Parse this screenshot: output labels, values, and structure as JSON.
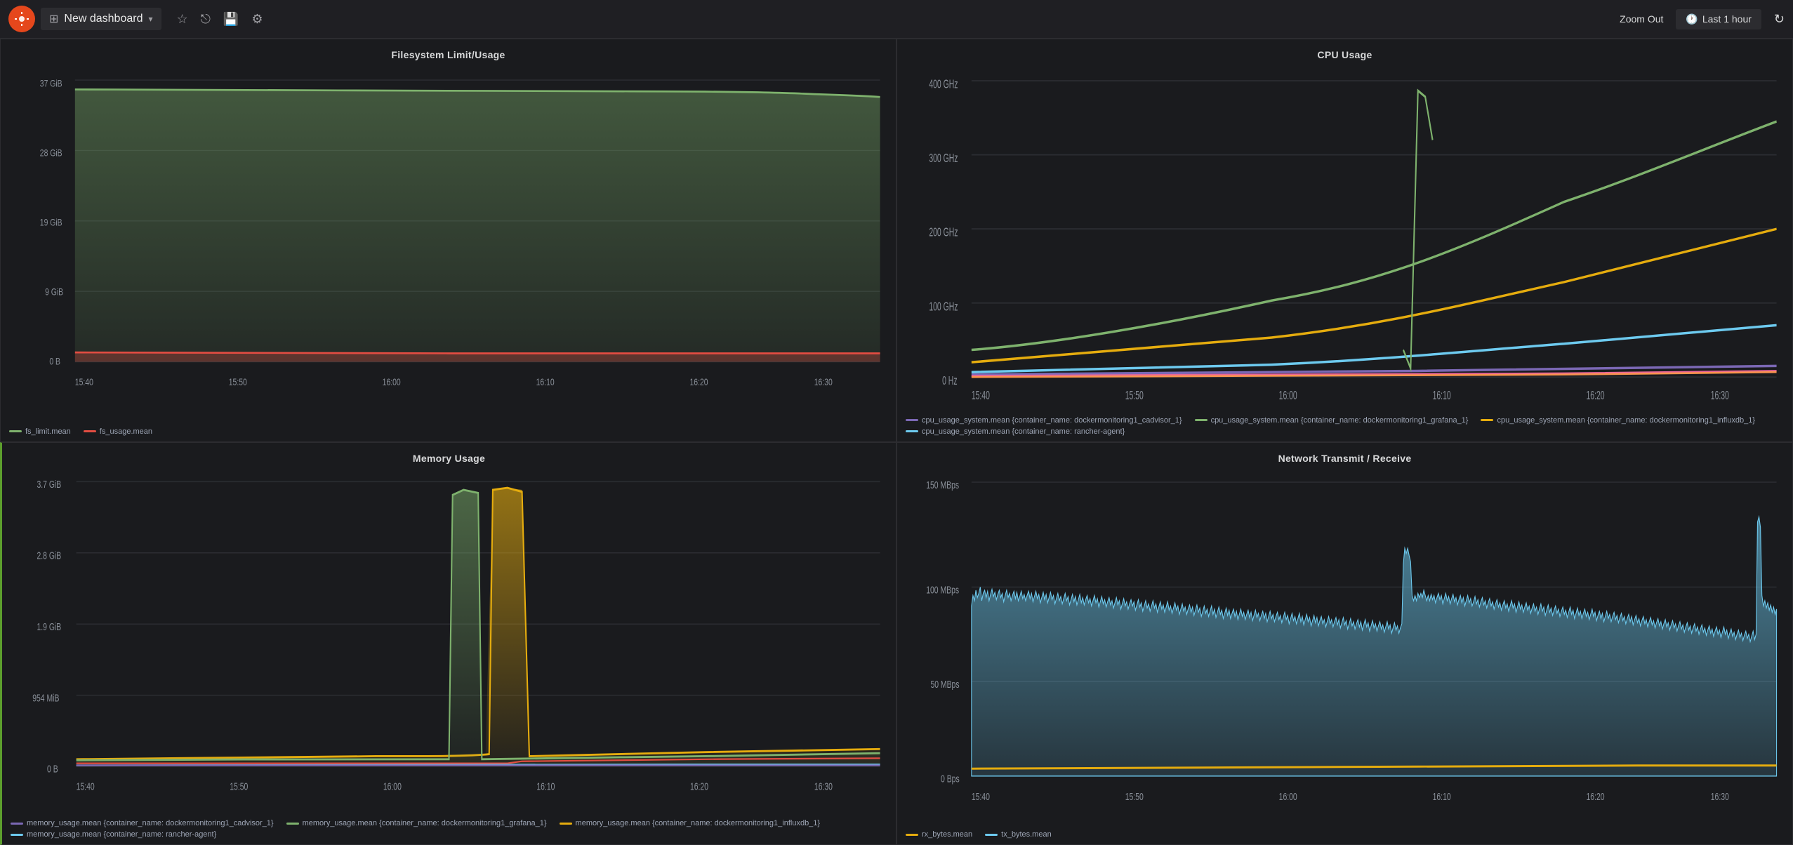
{
  "header": {
    "title": "New dashboard",
    "zoom_out": "Zoom Out",
    "time_range": "Last 1 hour",
    "logo_symbol": "☀"
  },
  "panels": {
    "filesystem": {
      "title": "Filesystem Limit/Usage",
      "y_labels": [
        "37 GiB",
        "28 GiB",
        "19 GiB",
        "9 GiB",
        "0 B"
      ],
      "x_labels": [
        "15:40",
        "15:50",
        "16:00",
        "16:10",
        "16:20",
        "16:30"
      ],
      "legend": [
        {
          "label": "fs_limit.mean",
          "color": "#7eb26d"
        },
        {
          "label": "fs_usage.mean",
          "color": "#e24d42"
        }
      ]
    },
    "cpu": {
      "title": "CPU Usage",
      "y_labels": [
        "400 GHz",
        "300 GHz",
        "200 GHz",
        "100 GHz",
        "0 Hz"
      ],
      "x_labels": [
        "15:40",
        "15:50",
        "16:00",
        "16:10",
        "16:20",
        "16:30"
      ],
      "legend": [
        {
          "label": "cpu_usage_system.mean {container_name: dockermonitoring1_cadvisor_1}",
          "color": "#7b68b5"
        },
        {
          "label": "cpu_usage_system.mean {container_name: dockermonitoring1_grafana_1}",
          "color": "#7eb26d"
        },
        {
          "label": "cpu_usage_system.mean {container_name: dockermonitoring1_influxdb_1}",
          "color": "#e5ac0e"
        },
        {
          "label": "cpu_usage_system.mean {container_name: rancher-agent}",
          "color": "#6dcaef"
        }
      ]
    },
    "memory": {
      "title": "Memory Usage",
      "y_labels": [
        "3.7 GiB",
        "2.8 GiB",
        "1.9 GiB",
        "954 MiB",
        "0 B"
      ],
      "x_labels": [
        "15:40",
        "15:50",
        "16:00",
        "16:10",
        "16:20",
        "16:30"
      ],
      "legend": [
        {
          "label": "memory_usage.mean {container_name: dockermonitoring1_cadvisor_1}",
          "color": "#7b68b5"
        },
        {
          "label": "memory_usage.mean {container_name: dockermonitoring1_grafana_1}",
          "color": "#7eb26d"
        },
        {
          "label": "memory_usage.mean {container_name: dockermonitoring1_influxdb_1}",
          "color": "#e5ac0e"
        },
        {
          "label": "memory_usage.mean {container_name: rancher-agent}",
          "color": "#6dcaef"
        }
      ]
    },
    "network": {
      "title": "Network Transmit / Receive",
      "y_labels": [
        "150 MBps",
        "100 MBps",
        "50 MBps",
        "0 Bps"
      ],
      "x_labels": [
        "15:40",
        "15:50",
        "16:00",
        "16:10",
        "16:20",
        "16:30"
      ],
      "legend": [
        {
          "label": "rx_bytes.mean",
          "color": "#e5ac0e"
        },
        {
          "label": "tx_bytes.mean",
          "color": "#6dcaef"
        }
      ]
    }
  }
}
